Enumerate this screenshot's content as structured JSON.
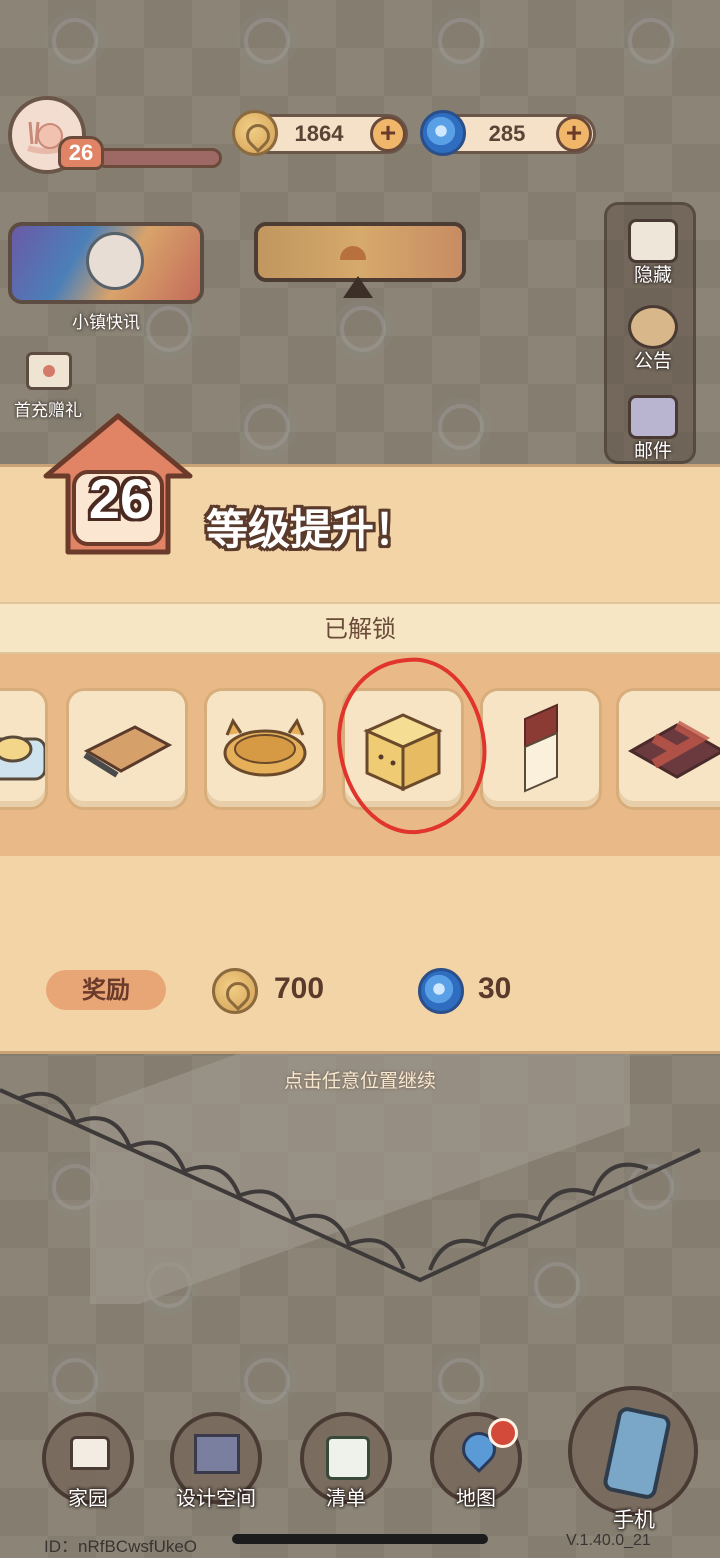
{
  "hud": {
    "player_level": "26",
    "coins": "1864",
    "gems": "285",
    "plus": "+"
  },
  "left": {
    "news_label": "小镇快讯",
    "gift_label": "首充赠礼"
  },
  "right_panel": {
    "hide_label": "隐藏",
    "notice_label": "公告",
    "mail_label": "邮件"
  },
  "modal": {
    "level": "26",
    "title": "等级提升！",
    "unlocked_label": "已解锁",
    "items": [
      "pudding-plate",
      "cutting-board",
      "cat-bowl",
      "cat-cube-seat",
      "wall-panel",
      "checker-rug"
    ],
    "reward_label": "奖励",
    "reward_coins": "700",
    "reward_gems": "30",
    "continue_hint": "点击任意位置继续"
  },
  "nav": {
    "home": "家园",
    "design": "设计空间",
    "list": "清单",
    "map": "地图",
    "phone": "手机"
  },
  "footer": {
    "id": "ID：nRfBCwsfUkeO",
    "version": "V.1.40.0_21"
  },
  "colors": {
    "annotation_red": "#e0342c",
    "modal_bg": "#f3d4a6",
    "house_badge": "#e08465"
  }
}
